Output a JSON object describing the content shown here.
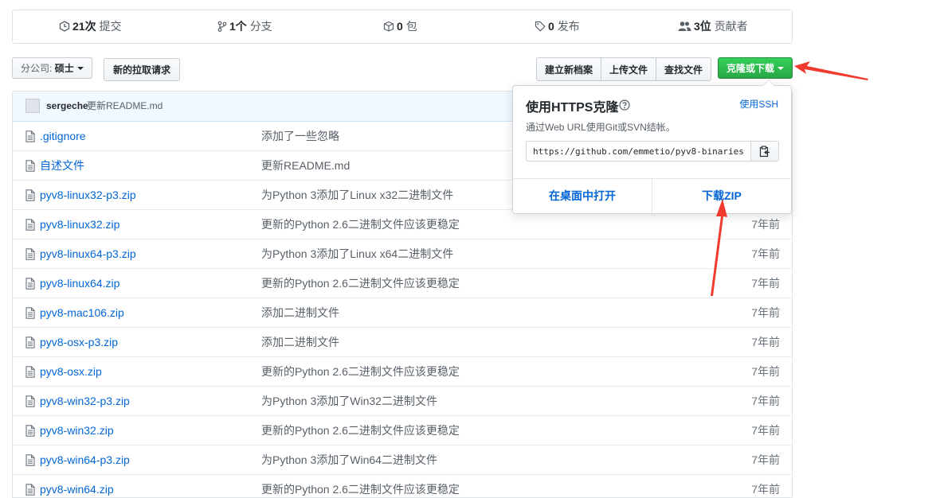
{
  "summary": {
    "commits": {
      "count": "21次",
      "label": "提交"
    },
    "branches": {
      "count": "1个",
      "label": "分支"
    },
    "packages": {
      "count": "0",
      "label": "包"
    },
    "releases": {
      "count": "0",
      "label": "发布"
    },
    "contributors": {
      "count": "3位",
      "label": "贡献者"
    }
  },
  "toolbar": {
    "branch_label": "分公司:",
    "branch_value": "硕士",
    "pull_request": "新的拉取请求",
    "create_file": "建立新档案",
    "upload_files": "上传文件",
    "find_file": "查找文件",
    "clone_download": "克隆或下载"
  },
  "commit": {
    "author": "sergeche",
    "message": "更新README.md"
  },
  "files": [
    {
      "name": ".gitignore",
      "message": "添加了一些忽略",
      "age": ""
    },
    {
      "name": "自述文件",
      "message": "更新README.md",
      "age": ""
    },
    {
      "name": "pyv8-linux32-p3.zip",
      "message": "为Python 3添加了Linux x32二进制文件",
      "age": ""
    },
    {
      "name": "pyv8-linux32.zip",
      "message": "更新的Python 2.6二进制文件应该更稳定",
      "age": "7年前"
    },
    {
      "name": "pyv8-linux64-p3.zip",
      "message": "为Python 3添加了Linux x64二进制文件",
      "age": "7年前"
    },
    {
      "name": "pyv8-linux64.zip",
      "message": "更新的Python 2.6二进制文件应该更稳定",
      "age": "7年前"
    },
    {
      "name": "pyv8-mac106.zip",
      "message": "添加二进制文件",
      "age": "7年前"
    },
    {
      "name": "pyv8-osx-p3.zip",
      "message": "添加二进制文件",
      "age": "7年前"
    },
    {
      "name": "pyv8-osx.zip",
      "message": "更新的Python 2.6二进制文件应该更稳定",
      "age": "7年前"
    },
    {
      "name": "pyv8-win32-p3.zip",
      "message": "为Python 3添加了Win32二进制文件",
      "age": "7年前"
    },
    {
      "name": "pyv8-win32.zip",
      "message": "更新的Python 2.6二进制文件应该更稳定",
      "age": "7年前"
    },
    {
      "name": "pyv8-win64-p3.zip",
      "message": "为Python 3添加了Win64二进制文件",
      "age": "7年前"
    },
    {
      "name": "pyv8-win64.zip",
      "message": "更新的Python 2.6二进制文件应该更稳定",
      "age": "7年前"
    }
  ],
  "clone": {
    "title": "使用HTTPS克隆",
    "use_ssh": "使用SSH",
    "description": "通过Web URL使用Git或SVN结帐。",
    "url": "https://github.com/emmetio/pyv8-binaries",
    "open_desktop": "在桌面中打开",
    "download_zip": "下载ZIP"
  },
  "colors": {
    "link": "#0366d6",
    "clone_button": "#28a745",
    "annotation_arrow": "#f03a2e"
  }
}
